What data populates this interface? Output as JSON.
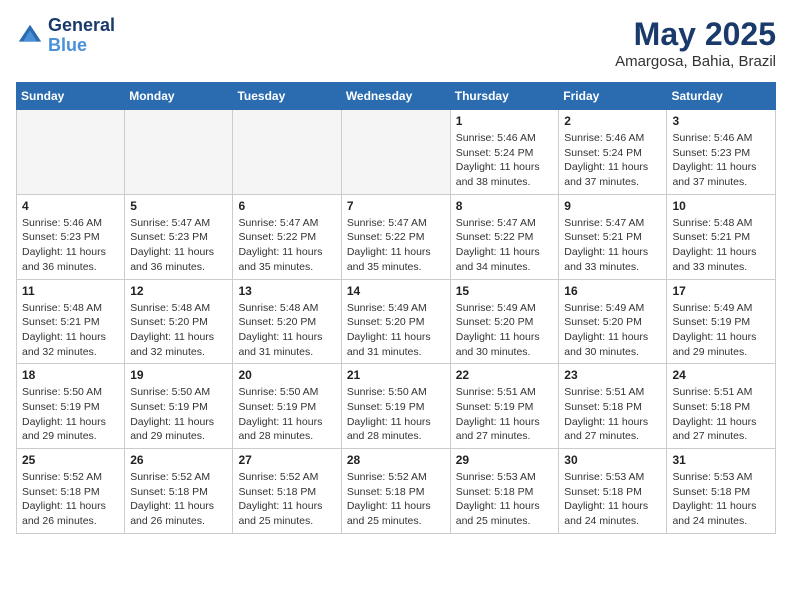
{
  "header": {
    "logo_line1": "General",
    "logo_line2": "Blue",
    "month": "May 2025",
    "location": "Amargosa, Bahia, Brazil"
  },
  "weekdays": [
    "Sunday",
    "Monday",
    "Tuesday",
    "Wednesday",
    "Thursday",
    "Friday",
    "Saturday"
  ],
  "weeks": [
    [
      {
        "day": "",
        "info": ""
      },
      {
        "day": "",
        "info": ""
      },
      {
        "day": "",
        "info": ""
      },
      {
        "day": "",
        "info": ""
      },
      {
        "day": "1",
        "info": "Sunrise: 5:46 AM\nSunset: 5:24 PM\nDaylight: 11 hours and 38 minutes."
      },
      {
        "day": "2",
        "info": "Sunrise: 5:46 AM\nSunset: 5:24 PM\nDaylight: 11 hours and 37 minutes."
      },
      {
        "day": "3",
        "info": "Sunrise: 5:46 AM\nSunset: 5:23 PM\nDaylight: 11 hours and 37 minutes."
      }
    ],
    [
      {
        "day": "4",
        "info": "Sunrise: 5:46 AM\nSunset: 5:23 PM\nDaylight: 11 hours and 36 minutes."
      },
      {
        "day": "5",
        "info": "Sunrise: 5:47 AM\nSunset: 5:23 PM\nDaylight: 11 hours and 36 minutes."
      },
      {
        "day": "6",
        "info": "Sunrise: 5:47 AM\nSunset: 5:22 PM\nDaylight: 11 hours and 35 minutes."
      },
      {
        "day": "7",
        "info": "Sunrise: 5:47 AM\nSunset: 5:22 PM\nDaylight: 11 hours and 35 minutes."
      },
      {
        "day": "8",
        "info": "Sunrise: 5:47 AM\nSunset: 5:22 PM\nDaylight: 11 hours and 34 minutes."
      },
      {
        "day": "9",
        "info": "Sunrise: 5:47 AM\nSunset: 5:21 PM\nDaylight: 11 hours and 33 minutes."
      },
      {
        "day": "10",
        "info": "Sunrise: 5:48 AM\nSunset: 5:21 PM\nDaylight: 11 hours and 33 minutes."
      }
    ],
    [
      {
        "day": "11",
        "info": "Sunrise: 5:48 AM\nSunset: 5:21 PM\nDaylight: 11 hours and 32 minutes."
      },
      {
        "day": "12",
        "info": "Sunrise: 5:48 AM\nSunset: 5:20 PM\nDaylight: 11 hours and 32 minutes."
      },
      {
        "day": "13",
        "info": "Sunrise: 5:48 AM\nSunset: 5:20 PM\nDaylight: 11 hours and 31 minutes."
      },
      {
        "day": "14",
        "info": "Sunrise: 5:49 AM\nSunset: 5:20 PM\nDaylight: 11 hours and 31 minutes."
      },
      {
        "day": "15",
        "info": "Sunrise: 5:49 AM\nSunset: 5:20 PM\nDaylight: 11 hours and 30 minutes."
      },
      {
        "day": "16",
        "info": "Sunrise: 5:49 AM\nSunset: 5:20 PM\nDaylight: 11 hours and 30 minutes."
      },
      {
        "day": "17",
        "info": "Sunrise: 5:49 AM\nSunset: 5:19 PM\nDaylight: 11 hours and 29 minutes."
      }
    ],
    [
      {
        "day": "18",
        "info": "Sunrise: 5:50 AM\nSunset: 5:19 PM\nDaylight: 11 hours and 29 minutes."
      },
      {
        "day": "19",
        "info": "Sunrise: 5:50 AM\nSunset: 5:19 PM\nDaylight: 11 hours and 29 minutes."
      },
      {
        "day": "20",
        "info": "Sunrise: 5:50 AM\nSunset: 5:19 PM\nDaylight: 11 hours and 28 minutes."
      },
      {
        "day": "21",
        "info": "Sunrise: 5:50 AM\nSunset: 5:19 PM\nDaylight: 11 hours and 28 minutes."
      },
      {
        "day": "22",
        "info": "Sunrise: 5:51 AM\nSunset: 5:19 PM\nDaylight: 11 hours and 27 minutes."
      },
      {
        "day": "23",
        "info": "Sunrise: 5:51 AM\nSunset: 5:18 PM\nDaylight: 11 hours and 27 minutes."
      },
      {
        "day": "24",
        "info": "Sunrise: 5:51 AM\nSunset: 5:18 PM\nDaylight: 11 hours and 27 minutes."
      }
    ],
    [
      {
        "day": "25",
        "info": "Sunrise: 5:52 AM\nSunset: 5:18 PM\nDaylight: 11 hours and 26 minutes."
      },
      {
        "day": "26",
        "info": "Sunrise: 5:52 AM\nSunset: 5:18 PM\nDaylight: 11 hours and 26 minutes."
      },
      {
        "day": "27",
        "info": "Sunrise: 5:52 AM\nSunset: 5:18 PM\nDaylight: 11 hours and 25 minutes."
      },
      {
        "day": "28",
        "info": "Sunrise: 5:52 AM\nSunset: 5:18 PM\nDaylight: 11 hours and 25 minutes."
      },
      {
        "day": "29",
        "info": "Sunrise: 5:53 AM\nSunset: 5:18 PM\nDaylight: 11 hours and 25 minutes."
      },
      {
        "day": "30",
        "info": "Sunrise: 5:53 AM\nSunset: 5:18 PM\nDaylight: 11 hours and 24 minutes."
      },
      {
        "day": "31",
        "info": "Sunrise: 5:53 AM\nSunset: 5:18 PM\nDaylight: 11 hours and 24 minutes."
      }
    ]
  ]
}
